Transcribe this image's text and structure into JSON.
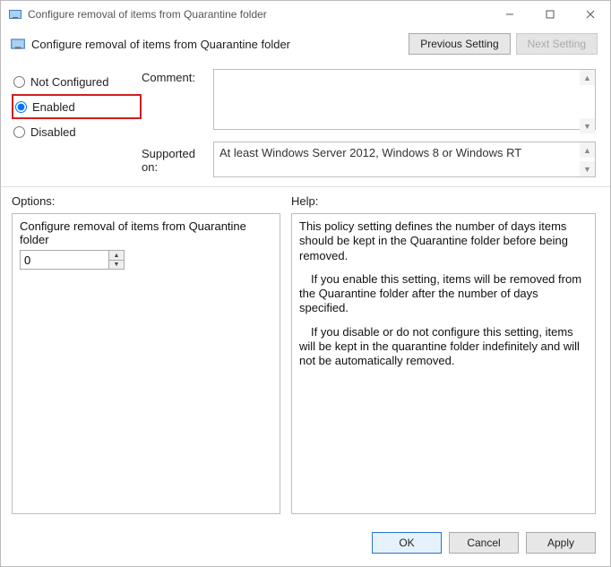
{
  "window": {
    "title": "Configure removal of items from Quarantine folder"
  },
  "header": {
    "title": "Configure removal of items from Quarantine folder",
    "prev_btn": "Previous Setting",
    "next_btn": "Next Setting"
  },
  "state": {
    "not_configured": "Not Configured",
    "enabled": "Enabled",
    "disabled": "Disabled",
    "selected": "enabled"
  },
  "labels": {
    "comment": "Comment:",
    "supported": "Supported on:",
    "options": "Options:",
    "help": "Help:"
  },
  "comment_value": "",
  "supported_value": "At least Windows Server 2012, Windows 8 or Windows RT",
  "options": {
    "label": "Configure removal of items from Quarantine folder",
    "value": "0"
  },
  "help": {
    "p1": "This policy setting defines the number of days items should be kept in the Quarantine folder before being removed.",
    "p2": "If you enable this setting, items will be removed from the Quarantine folder after the number of days specified.",
    "p3": "If you disable or do not configure this setting, items will be kept in the quarantine folder indefinitely and will not be automatically removed."
  },
  "footer": {
    "ok": "OK",
    "cancel": "Cancel",
    "apply": "Apply"
  }
}
